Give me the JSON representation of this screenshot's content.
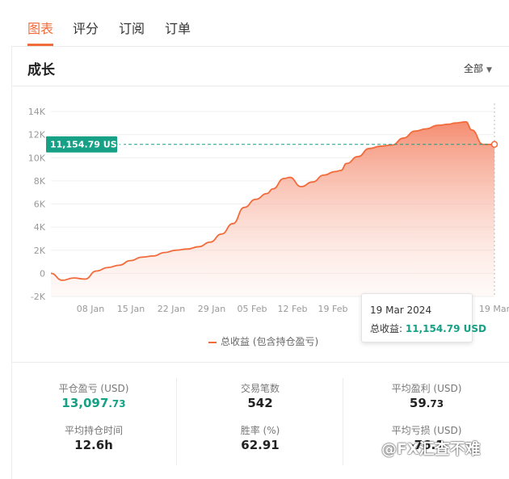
{
  "tabs": [
    {
      "label": "图表",
      "active": true
    },
    {
      "label": "评分",
      "active": false
    },
    {
      "label": "订阅",
      "active": false
    },
    {
      "label": "订单",
      "active": false
    }
  ],
  "section": {
    "title": "成长",
    "filter_label": "全部"
  },
  "chart_data": {
    "type": "area",
    "y_ticks": [
      "14K",
      "12K",
      "10K",
      "8K",
      "6K",
      "4K",
      "2K",
      "0",
      "-2K"
    ],
    "ylim": [
      -2000,
      14000
    ],
    "x_ticks": [
      "08 Jan",
      "15 Jan",
      "22 Jan",
      "29 Jan",
      "05 Feb",
      "12 Feb",
      "19 Feb",
      "19 Mar"
    ],
    "x": [
      0,
      2,
      4,
      6,
      8,
      10,
      12,
      14,
      16,
      18,
      20,
      22,
      24,
      26,
      28,
      30,
      32,
      34,
      36,
      38,
      39,
      41,
      42,
      44,
      46,
      48,
      50,
      51,
      52,
      54,
      56,
      58,
      60,
      62,
      64,
      66,
      68,
      70,
      71,
      73,
      74,
      76,
      77,
      78
    ],
    "y": [
      0,
      -600,
      -400,
      -500,
      200,
      500,
      700,
      1100,
      1400,
      1500,
      1800,
      2000,
      2100,
      2300,
      2700,
      3400,
      4300,
      5700,
      6400,
      6900,
      7300,
      8200,
      8300,
      7500,
      7900,
      8500,
      8800,
      8900,
      9500,
      10100,
      10800,
      11000,
      11100,
      11700,
      12300,
      12500,
      12800,
      12900,
      13000,
      13100,
      12400,
      11154.79,
      11154.79,
      11154.79
    ],
    "series": [
      {
        "name": "总收益 (包含持仓盈亏)"
      }
    ],
    "marker_label": "11,154.79 USD",
    "grid": true,
    "colors": {
      "line": "#f26b3a",
      "fill_top": "#f4876a",
      "marker": "#16a085"
    }
  },
  "tooltip": {
    "date": "19 Mar 2024",
    "label": "总收益: ",
    "value": "11,154.79 USD"
  },
  "legend": {
    "label": "总收益 (包含持仓盈亏)"
  },
  "stats": [
    {
      "label": "平仓盈亏 (USD)",
      "main": "13,097",
      "dec": ".73",
      "green": true
    },
    {
      "label": "交易笔数",
      "main": "542",
      "dec": "",
      "green": false
    },
    {
      "label": "平均盈利 (USD)",
      "main": "59",
      "dec": ".73",
      "green": false
    },
    {
      "label": "平均持仓时间",
      "main": "12.6h",
      "dec": "",
      "green": false
    },
    {
      "label": "胜率 (%)",
      "main": "62.91",
      "dec": "",
      "green": false
    },
    {
      "label": "平均亏损 (USD)",
      "main": "-76.1",
      "dec": "",
      "green": false
    }
  ],
  "watermark": "@FX汇查不难"
}
